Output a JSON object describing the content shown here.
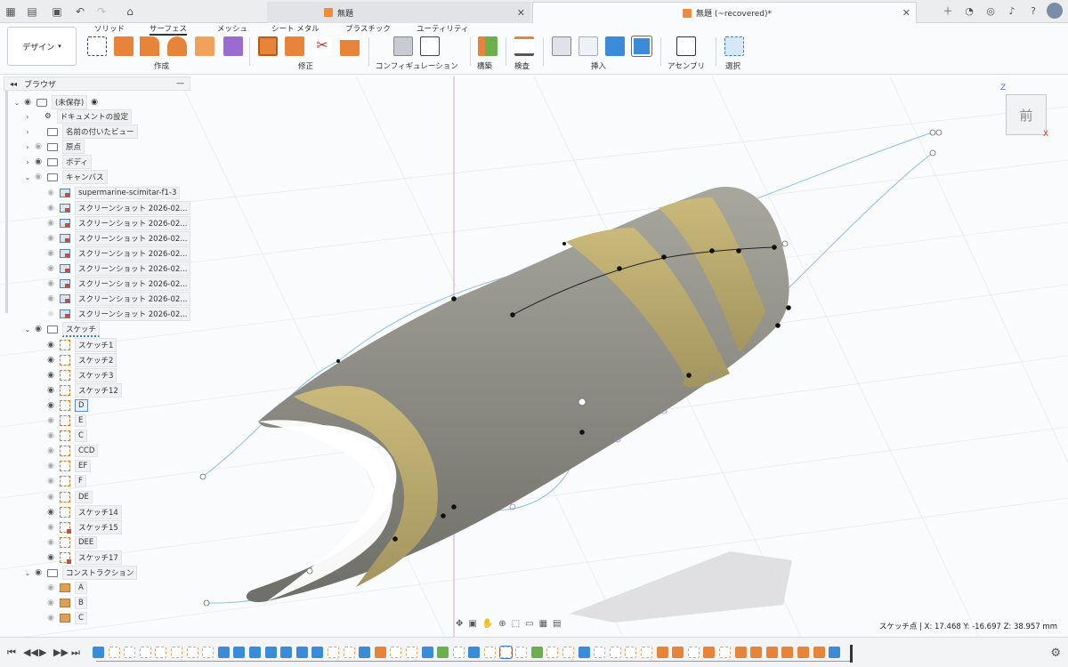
{
  "titlebar": {
    "tabs": [
      {
        "label": "無題",
        "active": false
      },
      {
        "label": "無題 (~recovered)*",
        "active": true
      }
    ]
  },
  "ribbon": {
    "workspace": "デザイン",
    "tabs": [
      "ソリッド",
      "サーフェス",
      "メッシュ",
      "シート メタル",
      "プラスチック",
      "ユーティリティ"
    ],
    "active_tab": "サーフェス",
    "groups": [
      "作成",
      "修正",
      "コンフィギュレーション",
      "構築",
      "検査",
      "挿入",
      "アセンブリ",
      "選択"
    ]
  },
  "browser": {
    "title": "ブラウザ",
    "root": "(未保存)",
    "items": [
      {
        "label": "ドキュメントの設定",
        "type": "settings"
      },
      {
        "label": "名前の付いたビュー",
        "type": "folder"
      },
      {
        "label": "原点",
        "type": "folder"
      },
      {
        "label": "ボディ",
        "type": "folder"
      },
      {
        "label": "キャンバス",
        "type": "folder"
      },
      {
        "label": "supermarine-scimitar-f1-3",
        "type": "canvas"
      },
      {
        "label": "スクリーンショット 2026-02...",
        "type": "canvas"
      },
      {
        "label": "スクリーンショット 2026-02...",
        "type": "canvas"
      },
      {
        "label": "スクリーンショット 2026-02...",
        "type": "canvas"
      },
      {
        "label": "スクリーンショット 2026-02...",
        "type": "canvas"
      },
      {
        "label": "スクリーンショット 2026-02...",
        "type": "canvas"
      },
      {
        "label": "スクリーンショット 2026-02...",
        "type": "canvas"
      },
      {
        "label": "スクリーンショット 2026-02...",
        "type": "canvas"
      },
      {
        "label": "スクリーンショット 2026-02...",
        "type": "canvas"
      },
      {
        "label": "スケッチ",
        "type": "folder"
      },
      {
        "label": "スケッチ1",
        "type": "sketch"
      },
      {
        "label": "スケッチ2",
        "type": "sketch"
      },
      {
        "label": "スケッチ3",
        "type": "sketch"
      },
      {
        "label": "スケッチ12",
        "type": "sketch"
      },
      {
        "label": "D",
        "type": "sketch"
      },
      {
        "label": "E",
        "type": "sketch"
      },
      {
        "label": "C",
        "type": "sketch"
      },
      {
        "label": "CCD",
        "type": "sketch"
      },
      {
        "label": "EF",
        "type": "sketch"
      },
      {
        "label": "F",
        "type": "sketch"
      },
      {
        "label": "DE",
        "type": "sketch"
      },
      {
        "label": "スケッチ14",
        "type": "sketch"
      },
      {
        "label": "スケッチ15",
        "type": "sketch"
      },
      {
        "label": "DEE",
        "type": "sketch"
      },
      {
        "label": "スケッチ17",
        "type": "sketch"
      },
      {
        "label": "コンストラクション",
        "type": "folder"
      },
      {
        "label": "A",
        "type": "construction"
      },
      {
        "label": "B",
        "type": "construction"
      },
      {
        "label": "C",
        "type": "construction"
      }
    ]
  },
  "viewcube": {
    "face": "前",
    "axis_z": "Z",
    "axis_x": "X"
  },
  "status": {
    "coords": "スケッチ点 | X: 17.468 Y: -16.697 Z: 38.957 mm"
  },
  "colors": {
    "accent": "#1f6fd6",
    "surface_gray": "#8a8a82",
    "surface_gold": "#b9a96c",
    "sketch_blue": "#8ec0e0"
  }
}
